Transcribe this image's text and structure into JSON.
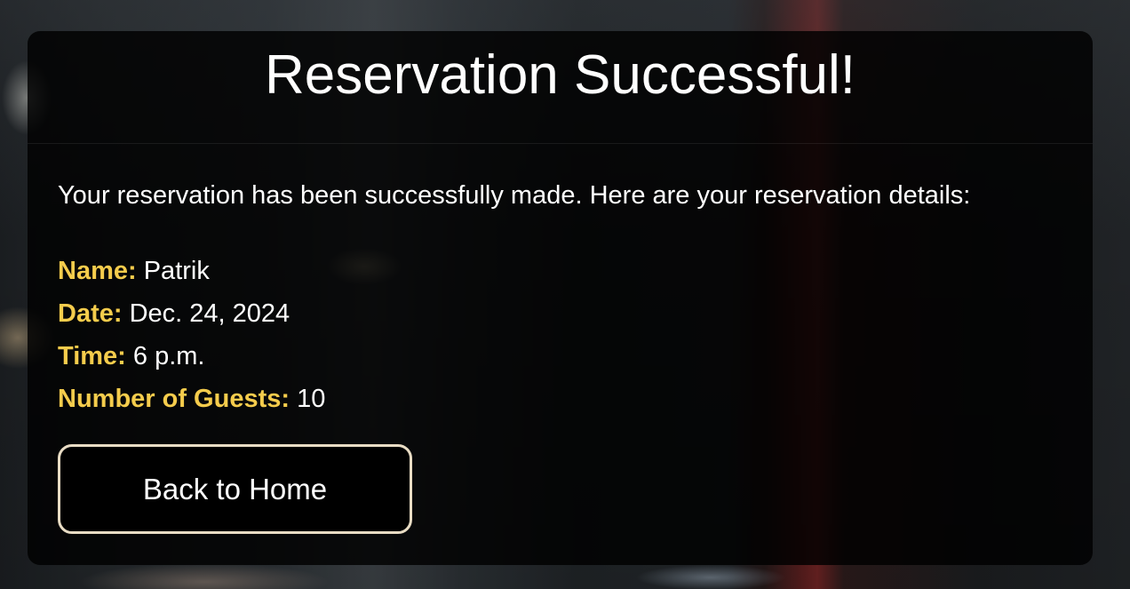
{
  "page": {
    "title": "Reservation Successful!",
    "intro": "Your reservation has been successfully made. Here are your reservation details:"
  },
  "details": [
    {
      "label": "Name:",
      "value": "Patrik"
    },
    {
      "label": "Date:",
      "value": "Dec. 24, 2024"
    },
    {
      "label": "Time:",
      "value": "6 p.m."
    },
    {
      "label": "Number of Guests:",
      "value": "10"
    }
  ],
  "actions": {
    "back_label": "Back to Home"
  },
  "colors": {
    "label_accent": "#f5cc4c",
    "button_border": "#e8dcc4",
    "card_background": "#000000"
  }
}
